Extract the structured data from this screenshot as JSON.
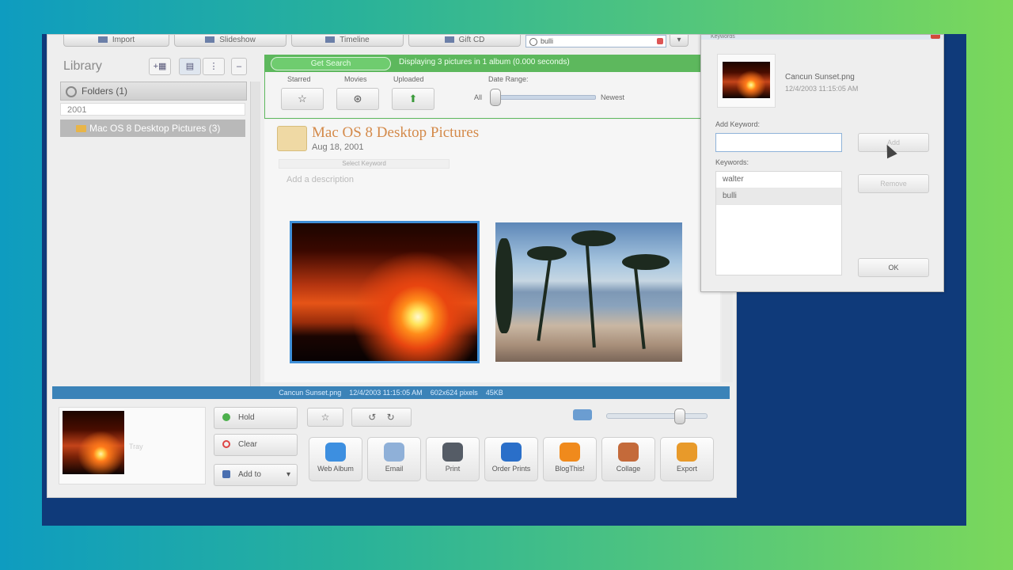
{
  "toolbar": {
    "import_label": "Import",
    "slideshow_label": "Slideshow",
    "timeline_label": "Timeline",
    "giftcd_label": "Gift CD",
    "search_value": "bulli"
  },
  "library": {
    "title": "Library",
    "folders_header": "Folders (1)",
    "year": "2001",
    "folder_item": "Mac OS 8 Desktop Pictures (3)"
  },
  "searchbar": {
    "get_search_label": "Get Search",
    "display_text": "Displaying 3 pictures in 1 album (0.000 seconds)"
  },
  "filters": {
    "starred": "Starred",
    "movies": "Movies",
    "uploaded": "Uploaded",
    "date_range": "Date Range:",
    "all": "All",
    "newest": "Newest"
  },
  "album": {
    "title": "Mac OS 8 Desktop Pictures",
    "date": "Aug 18, 2001",
    "select_keyword": "Select Keyword",
    "add_description": "Add a description"
  },
  "statusbar": {
    "filename": "Cancun Sunset.png",
    "date": "12/4/2003 11:15:05 AM",
    "dimensions": "602x624 pixels",
    "size": "45KB"
  },
  "tray": {
    "label": "Tray",
    "hold_label": "Hold",
    "clear_label": "Clear",
    "addto_label": "Add to"
  },
  "actions": [
    {
      "label": "Web Album",
      "color": "#3d8fe0"
    },
    {
      "label": "Email",
      "color": "#8fb0d8"
    },
    {
      "label": "Print",
      "color": "#555c66"
    },
    {
      "label": "Order Prints",
      "color": "#2a6fc9"
    },
    {
      "label": "BlogThis!",
      "color": "#f08a1c"
    },
    {
      "label": "Collage",
      "color": "#c46a3a"
    },
    {
      "label": "Export",
      "color": "#e89a2a"
    }
  ],
  "dialog": {
    "title": "Keywords",
    "file_name": "Cancun Sunset.png",
    "file_date": "12/4/2003 11:15:05 AM",
    "add_keyword_label": "Add Keyword:",
    "keywords_label": "Keywords:",
    "keywords": [
      "walter",
      "bulli"
    ],
    "add_button": "Add",
    "remove_button": "Remove",
    "ok_button": "OK"
  }
}
